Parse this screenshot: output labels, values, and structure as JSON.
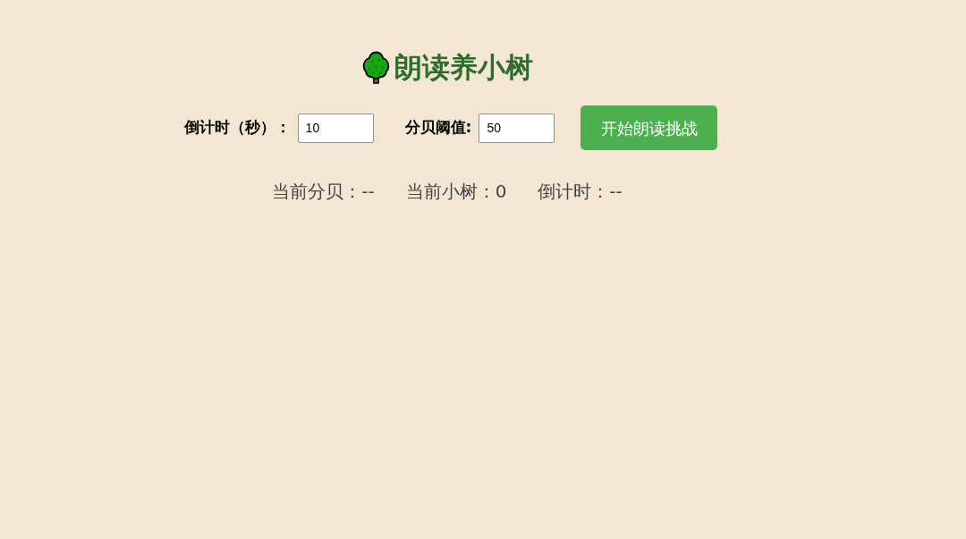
{
  "title": "朗读养小树",
  "settings": [
    {
      "label": "倒计时（秒）：",
      "value": "10"
    },
    {
      "label": "分贝阈值:",
      "value": "50"
    }
  ],
  "start_button": "开始朗读挑战",
  "stats": [
    "当前分贝：--",
    "当前小树：0",
    "倒计时：--"
  ]
}
